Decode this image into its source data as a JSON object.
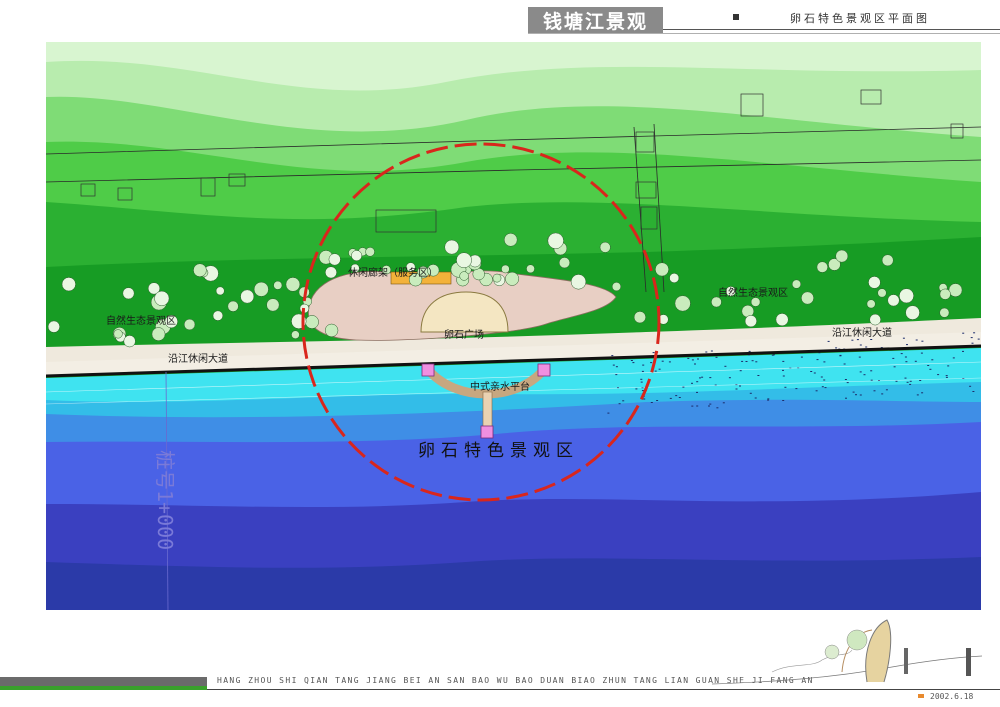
{
  "header": {
    "title": "钱塘江景观",
    "subtitle": "卵石特色景观区平面图"
  },
  "map": {
    "labels": {
      "leisure_gallery": "休闲廊架（服务区）",
      "eco_zone_left": "自然生态景观区",
      "eco_zone_right": "自然生态景观区",
      "pebble_plaza": "卵石广场",
      "riverside_avenue_left": "沿江休闲大道",
      "riverside_avenue_right": "沿江休闲大道",
      "waterfront_platform": "中式亲水平台",
      "zone_title": "卵石特色景观区",
      "station_mark": "桩号1+000"
    },
    "colors": {
      "highlight_circle": "#d9261c",
      "river_deep": "#2b3aa8",
      "river_shallow": "#3fe3f0",
      "green_dark": "#1f9a2a",
      "green_light": "#b6ecb0"
    }
  },
  "footer": {
    "pinyin": "HANG ZHOU SHI QIAN TANG JIANG BEI AN SAN BAO WU BAO DUAN BIAO ZHUN TANG LIAN GUAN SHE JI FANG AN",
    "date": "2002.6.18"
  }
}
